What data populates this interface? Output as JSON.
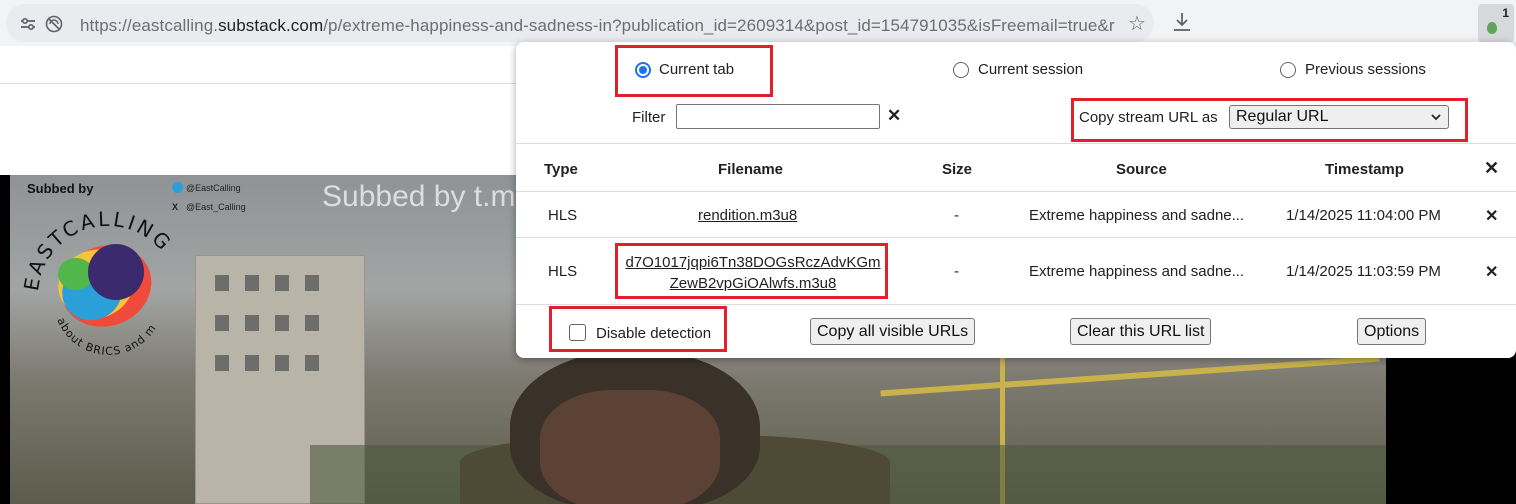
{
  "browser": {
    "url_prefix": "https://eastcalling.",
    "url_domain": "substack.com",
    "url_suffix": "/p/extreme-happiness-and-sadness-in?publication_id=2609314&post_id=154791035&isFreemail=true&r",
    "extension_badge": "1",
    "icons": [
      "tune-icon",
      "no-tracking-icon",
      "star-icon",
      "download-icon",
      "extension-icon"
    ]
  },
  "video": {
    "subbed_small": "Subbed by",
    "subbed_big": "Subbed by t.m",
    "telegram_handle": "@EastCalling",
    "x_handle": "@East_Calling",
    "logo_text_top": "EASTCALLING",
    "logo_text_bottom": "about BRICS and more"
  },
  "popup": {
    "tabs": [
      {
        "label": "Current tab",
        "checked": true
      },
      {
        "label": "Current session",
        "checked": false
      },
      {
        "label": "Previous sessions",
        "checked": false
      }
    ],
    "filter_label": "Filter",
    "filter_value": "",
    "filter_clear": "✕",
    "copy_label": "Copy stream URL as",
    "copy_selected": "Regular URL",
    "columns": [
      "Type",
      "Filename",
      "Size",
      "Source",
      "Timestamp"
    ],
    "header_close": "✕",
    "rows": [
      {
        "type": "HLS",
        "filename_line1": "rendition.m3u8",
        "filename_line2": "",
        "size": "-",
        "source": "Extreme happiness and sadne...",
        "timestamp": "1/14/2025 11:04:00 PM",
        "close": "✕"
      },
      {
        "type": "HLS",
        "filename_line1": "d7O1017jqpi6Tn38DOGsRczAdvKGm",
        "filename_line2": "ZewB2vpGiOAlwfs.m3u8",
        "size": "-",
        "source": "Extreme happiness and sadne...",
        "timestamp": "1/14/2025 11:03:59 PM",
        "close": "✕"
      }
    ],
    "disable_detection_label": "Disable detection",
    "disable_detection_checked": false,
    "buttons": {
      "copy_all": "Copy all visible URLs",
      "clear": "Clear this URL list",
      "options": "Options"
    },
    "highlight_color": "#e0202a",
    "accent_color": "#1a73e8"
  }
}
